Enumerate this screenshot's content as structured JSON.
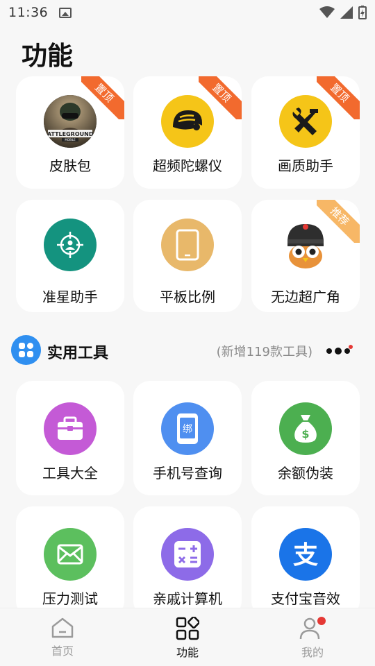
{
  "status_bar": {
    "time": "11:36"
  },
  "page_title": "功能",
  "top_tools": [
    {
      "label": "皮肤包",
      "icon": "pubg-battlegrounds-logo-icon",
      "ribbon": "置顶",
      "logo_text": "BATTLEGROUNDS",
      "logo_sub": "MOBILE"
    },
    {
      "label": "超频陀螺仪",
      "icon": "helmet-icon",
      "ribbon": "置顶"
    },
    {
      "label": "画质助手",
      "icon": "tools-icon",
      "ribbon": "置顶"
    },
    {
      "label": "准星助手",
      "icon": "crosshair-icon",
      "ribbon": ""
    },
    {
      "label": "平板比例",
      "icon": "tablet-icon",
      "ribbon": ""
    },
    {
      "label": "无边超广角",
      "icon": "owl-helmet-icon",
      "ribbon": "推荐"
    }
  ],
  "section": {
    "title": "实用工具",
    "subtitle": "(新增119款工具)"
  },
  "utility_tools": [
    {
      "label": "工具大全",
      "icon": "toolbox-icon"
    },
    {
      "label": "手机号查询",
      "icon": "phone-bind-icon",
      "badge_text": "绑"
    },
    {
      "label": "余额伪装",
      "icon": "money-bag-icon"
    },
    {
      "label": "压力测试",
      "icon": "envelope-icon"
    },
    {
      "label": "亲戚计算机",
      "icon": "calculator-icon"
    },
    {
      "label": "支付宝音效",
      "icon": "alipay-icon",
      "badge_text": "支"
    }
  ],
  "bottom_nav": [
    {
      "label": "首页",
      "icon": "home-icon",
      "active": false
    },
    {
      "label": "功能",
      "icon": "grid-icon",
      "active": true
    },
    {
      "label": "我的",
      "icon": "profile-icon",
      "active": false,
      "has_dot": true
    }
  ],
  "colors": {
    "ribbon_top": "#f26a2e",
    "ribbon_recommend": "#f7b766",
    "yellow": "#f5c518",
    "teal": "#14937f",
    "tan": "#e8b86a",
    "purple": "#c45ad6",
    "blue": "#4f8ff0",
    "green": "#4caf50",
    "mail_green": "#5cbf5e",
    "calc_purple": "#8d6be8",
    "alipay_blue": "#1a74e8",
    "accent_dot": "#e53935"
  }
}
